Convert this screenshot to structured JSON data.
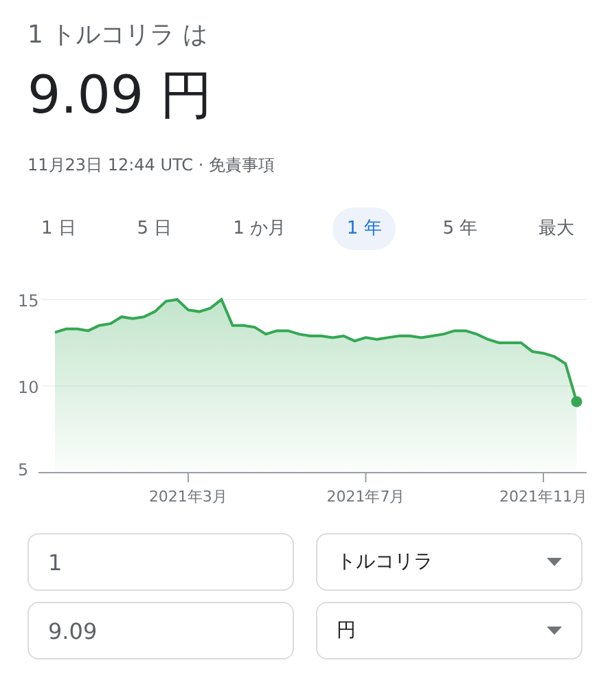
{
  "heading": "1 トルコリラ は",
  "price": "9.09 円",
  "timestamp": "11月23日 12:44 UTC · ",
  "disclaimer": "免責事項",
  "tabs": [
    {
      "label": "1 日",
      "selected": false
    },
    {
      "label": "5 日",
      "selected": false
    },
    {
      "label": "1 か月",
      "selected": false
    },
    {
      "label": "1 年",
      "selected": true
    },
    {
      "label": "5 年",
      "selected": false
    },
    {
      "label": "最大",
      "selected": false
    }
  ],
  "chart_data": {
    "type": "area",
    "categories": [
      null,
      null,
      null,
      null,
      null,
      null,
      null,
      null,
      null,
      null,
      null,
      null,
      "2021年3月",
      null,
      null,
      null,
      null,
      null,
      null,
      null,
      null,
      null,
      null,
      null,
      null,
      null,
      null,
      null,
      "2021年7月",
      null,
      null,
      null,
      null,
      null,
      null,
      null,
      null,
      null,
      null,
      null,
      null,
      null,
      null,
      null,
      "2021年11月",
      null,
      null,
      null
    ],
    "series": [
      {
        "color": "#34a853",
        "values": [
          13.1,
          13.3,
          13.3,
          13.2,
          13.5,
          13.6,
          14.0,
          13.9,
          14.0,
          14.3,
          14.9,
          15.0,
          14.4,
          14.3,
          14.5,
          15.0,
          13.5,
          13.5,
          13.4,
          13.0,
          13.2,
          13.2,
          13.0,
          12.9,
          12.9,
          12.8,
          12.9,
          12.6,
          12.8,
          12.7,
          12.8,
          12.9,
          12.9,
          12.8,
          12.9,
          13.0,
          13.2,
          13.2,
          13.0,
          12.7,
          12.5,
          12.5,
          12.5,
          12.0,
          11.9,
          11.7,
          11.3,
          9.1
        ]
      }
    ],
    "ylim": [
      5,
      15
    ],
    "yticks": [
      5,
      10,
      15
    ]
  },
  "converter": [
    {
      "amount": "1",
      "currency": "トルコリラ"
    },
    {
      "amount": "9.09",
      "currency": "円"
    }
  ]
}
